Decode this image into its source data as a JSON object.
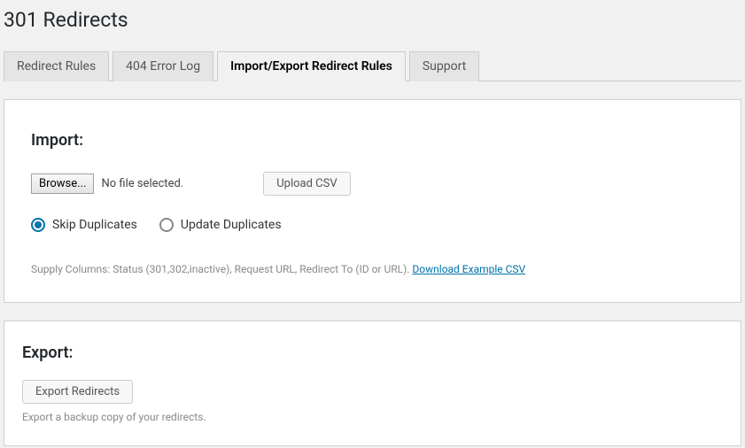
{
  "page": {
    "title": "301 Redirects"
  },
  "tabs": [
    {
      "label": "Redirect Rules",
      "active": false
    },
    {
      "label": "404 Error Log",
      "active": false
    },
    {
      "label": "Import/Export Redirect Rules",
      "active": true
    },
    {
      "label": "Support",
      "active": false
    }
  ],
  "import": {
    "heading": "Import:",
    "browse_label": "Browse...",
    "file_status": "No file selected.",
    "upload_label": "Upload CSV",
    "radio_skip": "Skip Duplicates",
    "radio_update": "Update Duplicates",
    "hint_prefix": "Supply Columns: Status (301,302,inactive), Request URL, Redirect To (ID or URL). ",
    "hint_link": "Download Example CSV"
  },
  "export": {
    "heading": "Export:",
    "button_label": "Export Redirects",
    "hint": "Export a backup copy of your redirects."
  }
}
